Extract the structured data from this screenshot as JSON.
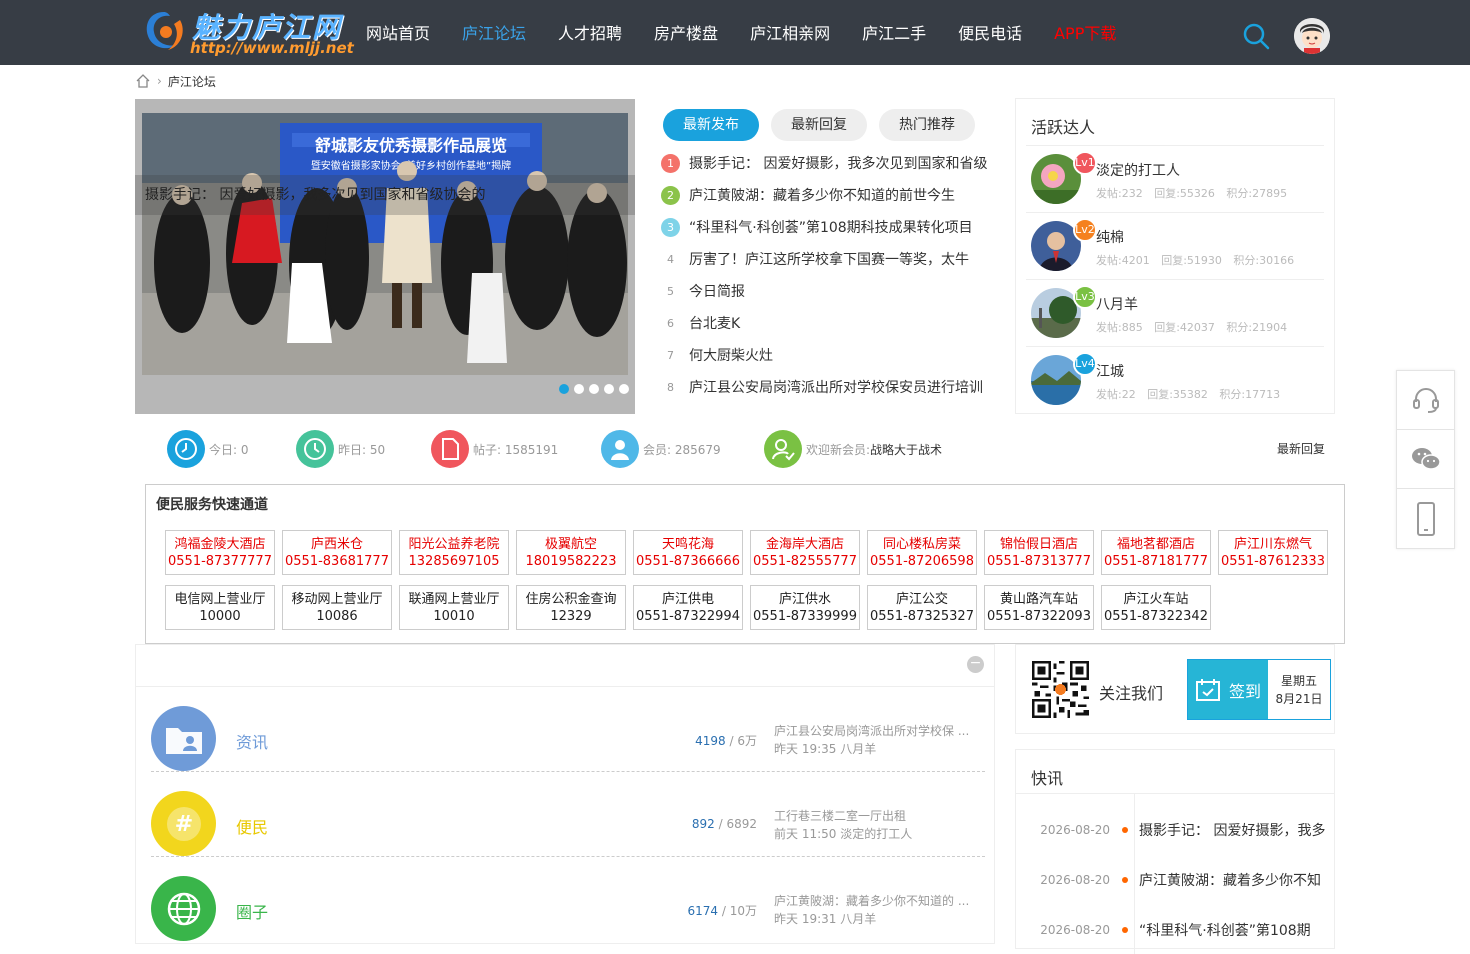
{
  "header": {
    "logo_text": "魅力庐江网",
    "logo_url": "http://www.mljj.net",
    "nav": [
      {
        "label": "网站首页"
      },
      {
        "label": "庐江论坛"
      },
      {
        "label": "人才招聘"
      },
      {
        "label": "房产楼盘"
      },
      {
        "label": "庐江相亲网"
      },
      {
        "label": "庐江二手"
      },
      {
        "label": "便民电话"
      },
      {
        "label": "APP下载"
      }
    ],
    "active_nav": "庐江论坛",
    "highlight_nav": "APP下载",
    "icons": [
      "search-icon",
      "user-avatar"
    ]
  },
  "breadcrumb": {
    "icon": "home-icon",
    "current": "庐江论坛"
  },
  "slideshow": {
    "caption": "摄影手记： 因爱好摄影，我多次见到国家和省级协会的",
    "banner_text": "舒城影友优秀摄影作品展览",
    "banner_sub": "暨安徽省摄影家协会“美好乡村创作基地”揭牌",
    "dot_count": 5,
    "active_dot": 0
  },
  "thread_tabs": [
    {
      "label": "最新发布"
    },
    {
      "label": "最新回复"
    },
    {
      "label": "热门推荐"
    }
  ],
  "threads": [
    {
      "num": "1",
      "title": "摄影手记： 因爱好摄影，我多次见到国家和省级"
    },
    {
      "num": "2",
      "title": "庐江黄陂湖：藏着多少你不知道的前世今生"
    },
    {
      "num": "3",
      "title": "“科里科气·科创荟”第108期科技成果转化项目"
    },
    {
      "num": "4",
      "title": "厉害了！庐江这所学校拿下国赛一等奖，太牛"
    },
    {
      "num": "5",
      "title": "今日简报"
    },
    {
      "num": "6",
      "title": "台北麦K"
    },
    {
      "num": "7",
      "title": "何大厨柴火灶"
    },
    {
      "num": "8",
      "title": "庐江县公安局岗湾派出所对学校保安员进行培训"
    }
  ],
  "active_users": {
    "title": "活跃达人",
    "users": [
      {
        "name": "淡定的打工人",
        "level": "Lv1",
        "posts": "发帖:232",
        "replies": "回复:55326",
        "points": "积分:27895",
        "color": "#f0565d"
      },
      {
        "name": "纯棉",
        "level": "Lv2",
        "posts": "发帖:4201",
        "replies": "回复:51930",
        "points": "积分:30166",
        "color": "#f5811f"
      },
      {
        "name": "八月羊",
        "level": "Lv3",
        "posts": "发帖:885",
        "replies": "回复:42037",
        "points": "积分:21904",
        "color": "#7ac143"
      },
      {
        "name": "江城",
        "level": "Lv4",
        "posts": "发帖:22",
        "replies": "回复:35382",
        "points": "积分:17713",
        "color": "#1aa2dd"
      }
    ]
  },
  "side_tools": [
    "headset-icon",
    "wechat-icon",
    "mobile-icon"
  ],
  "stats": {
    "today": "今日: 0",
    "yesterday": "昨日: 50",
    "posts": "帖子: 1585191",
    "members": "会员: 285679",
    "welcome_label": "欢迎新会员: ",
    "welcome_user": "战略大于战术",
    "latest_link": "最新回复"
  },
  "fast_service": {
    "title": "便民服务快速通道",
    "row1": [
      {
        "name": "鸿福金陵大酒店",
        "tel": "0551-87377777"
      },
      {
        "name": "庐西米仓",
        "tel": "0551-83681777"
      },
      {
        "name": "阳光公益养老院",
        "tel": "13285697105"
      },
      {
        "name": "极翼航空",
        "tel": "18019582223"
      },
      {
        "name": "天鸣花海",
        "tel": "0551-87366666"
      },
      {
        "name": "金海岸大酒店",
        "tel": "0551-82555777"
      },
      {
        "name": "同心楼私房菜",
        "tel": "0551-87206598"
      },
      {
        "name": "锦怡假日酒店",
        "tel": "0551-87313777"
      },
      {
        "name": "福地茗都酒店",
        "tel": "0551-87181777"
      },
      {
        "name": "庐江川东燃气",
        "tel": "0551-87612333"
      }
    ],
    "row2": [
      {
        "name": "电信网上营业厅",
        "tel": "10000"
      },
      {
        "name": "移动网上营业厅",
        "tel": "10086"
      },
      {
        "name": "联通网上营业厅",
        "tel": "10010"
      },
      {
        "name": "住房公积金查询",
        "tel": "12329"
      },
      {
        "name": "庐江供电",
        "tel": "0551-87322994"
      },
      {
        "name": "庐江供水",
        "tel": "0551-87339999"
      },
      {
        "name": "庐江公交",
        "tel": "0551-87325327"
      },
      {
        "name": "黄山路汽车站",
        "tel": "0551-87322093"
      },
      {
        "name": "庐江火车站",
        "tel": "0551-87322342"
      }
    ]
  },
  "forums": [
    {
      "name": "资讯",
      "today": "4198",
      "total": " / 6万",
      "last_title": "庐江县公安局岗湾派出所对学校保 ...",
      "last_meta": "昨天 19:35 八月羊",
      "color": "#6f9bd8",
      "name_color": "#6f9bd8",
      "icon": "folder-user-icon"
    },
    {
      "name": "便民",
      "today": "892",
      "total": " / 6892",
      "last_title": "工行巷三楼二室一厅出租",
      "last_meta": "前天 11:50 淡定的打工人",
      "color": "#f2d61d",
      "name_color": "#e8c800",
      "icon": "hashtag-icon"
    },
    {
      "name": "圈子",
      "today": "6174",
      "total": " / 10万",
      "last_title": "庐江黄陂湖：藏着多少你不知道的 ...",
      "last_meta": "昨天 19:31 八月羊",
      "color": "#39b54a",
      "name_color": "#39b54a",
      "icon": "globe-icon"
    }
  ],
  "follow": {
    "label": "关注我们",
    "sign_label": "签到",
    "weekday": "星期五",
    "date": "8月21日"
  },
  "news": {
    "title": "快讯",
    "items": [
      {
        "date": "2026-08-20",
        "title": "摄影手记： 因爱好摄影，我多"
      },
      {
        "date": "2026-08-20",
        "title": "庐江黄陂湖：藏着多少你不知"
      },
      {
        "date": "2026-08-20",
        "title": "“科里科气·科创荟”第108期"
      }
    ]
  }
}
